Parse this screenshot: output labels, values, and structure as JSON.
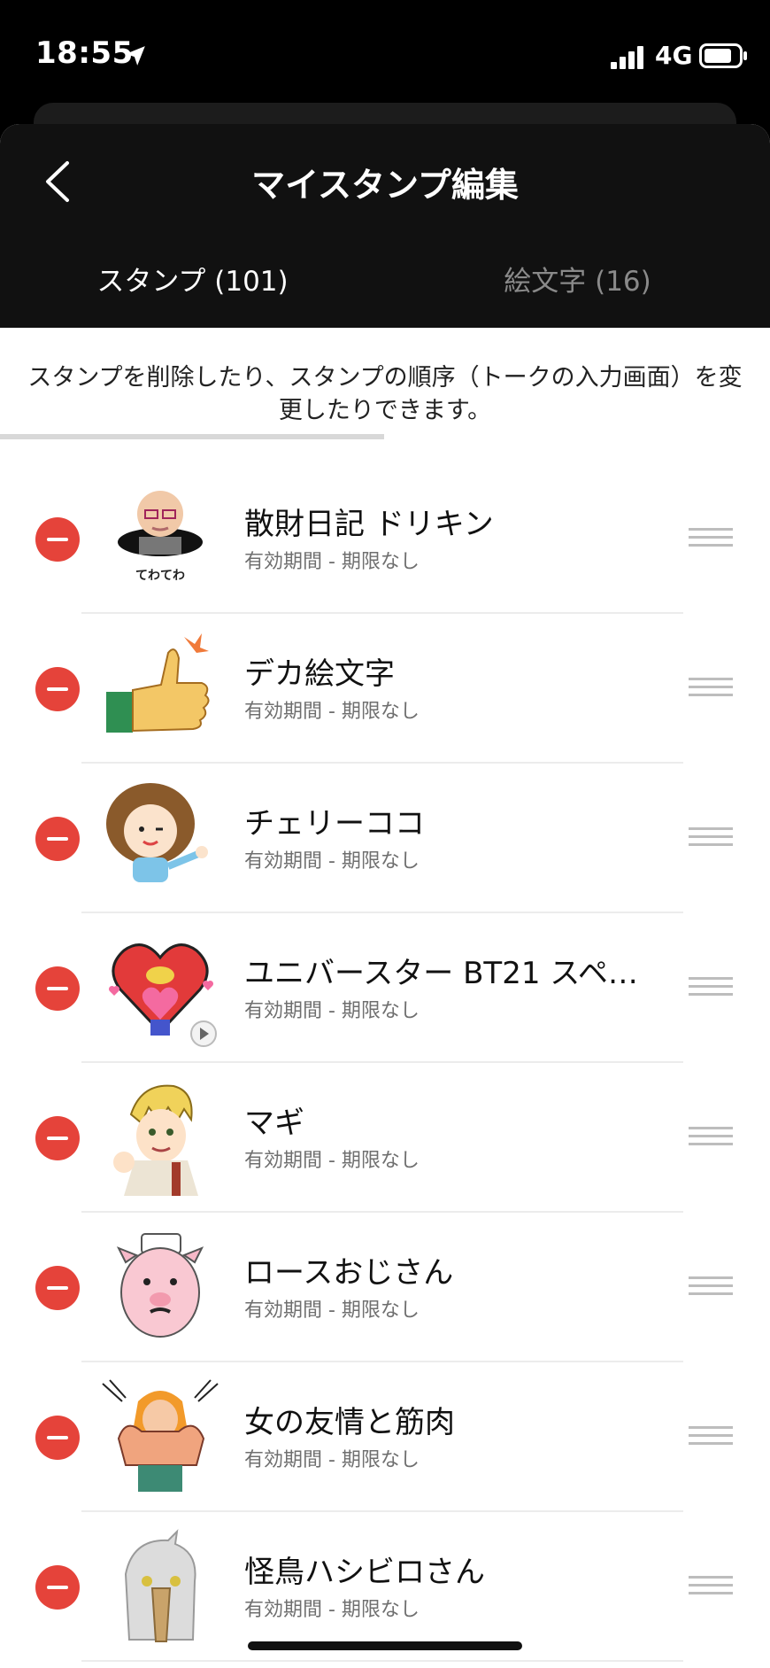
{
  "status_bar": {
    "time": "18:55",
    "network": "4G"
  },
  "header": {
    "title": "マイスタンプ編集"
  },
  "tabs": [
    {
      "label": "スタンプ (101)",
      "active": true
    },
    {
      "label": "絵文字 (16)",
      "active": false
    }
  ],
  "description": "スタンプを削除したり、スタンプの順序（トークの入力画面）を変更したりできます。",
  "items": [
    {
      "title": "散財日記 ドリキン",
      "subtitle": "有効期間 - 期限なし",
      "thumb_caption": "てわてわ"
    },
    {
      "title": "デカ絵文字",
      "subtitle": "有効期間 - 期限なし"
    },
    {
      "title": "チェリーココ",
      "subtitle": "有効期間 - 期限なし"
    },
    {
      "title": "ユニバースター BT21 スペ…",
      "subtitle": "有効期間 - 期限なし"
    },
    {
      "title": "マギ",
      "subtitle": "有効期間 - 期限なし"
    },
    {
      "title": "ロースおじさん",
      "subtitle": "有効期間 - 期限なし"
    },
    {
      "title": "女の友情と筋肉",
      "subtitle": "有効期間 - 期限なし"
    },
    {
      "title": "怪鳥ハシビロさん",
      "subtitle": "有効期間 - 期限なし"
    }
  ],
  "colors": {
    "delete": "#e5433a",
    "nav_bg": "#111111",
    "text_secondary": "#6f6f6f"
  }
}
